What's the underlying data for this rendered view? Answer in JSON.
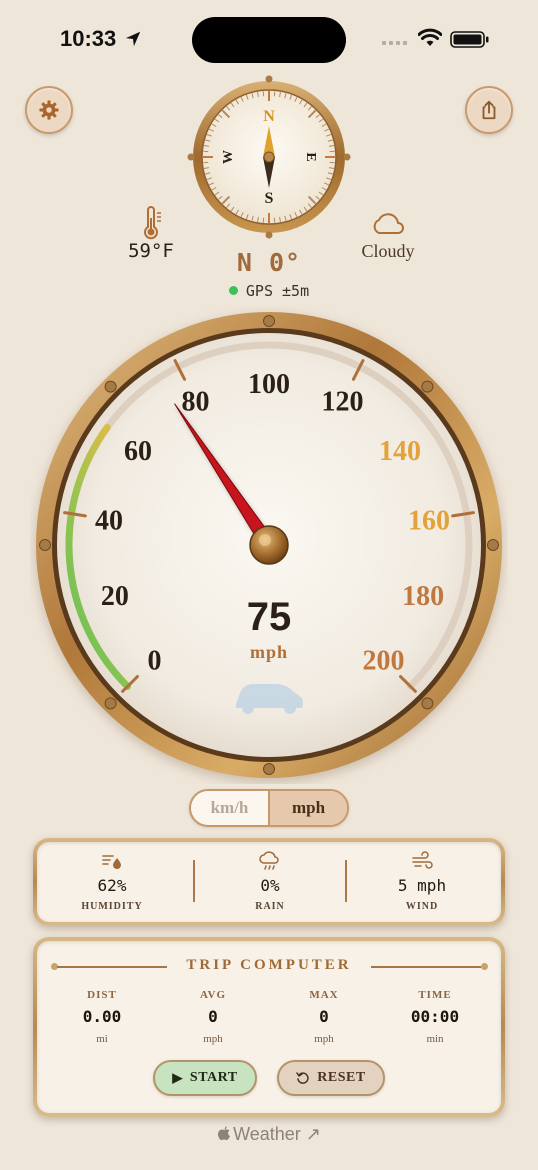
{
  "status": {
    "time": "10:33"
  },
  "header": {
    "temperature": "59°F",
    "condition": "Cloudy",
    "heading": "N 0°",
    "gps": "GPS ±5m"
  },
  "compass": {
    "n": "N",
    "e": "E",
    "s": "S",
    "w": "W"
  },
  "speedometer": {
    "speed": "75",
    "unit": "mph",
    "ticks": [
      {
        "label": "0",
        "warn": false
      },
      {
        "label": "20",
        "warn": false
      },
      {
        "label": "40",
        "warn": false
      },
      {
        "label": "60",
        "warn": false
      },
      {
        "label": "80",
        "warn": false
      },
      {
        "label": "100",
        "warn": false
      },
      {
        "label": "120",
        "warn": false
      },
      {
        "label": "140",
        "warn": true
      },
      {
        "label": "160",
        "warn": true
      },
      {
        "label": "180",
        "warn": true
      },
      {
        "label": "200",
        "warn": true
      }
    ],
    "max": 200,
    "needle_value": 75
  },
  "units": {
    "km": "km/h",
    "mph": "mph",
    "selected": "mph"
  },
  "weather": {
    "humidity": {
      "value": "62%",
      "label": "HUMIDITY"
    },
    "rain": {
      "value": "0%",
      "label": "RAIN"
    },
    "wind": {
      "value": "5 mph",
      "label": "WIND"
    }
  },
  "trip": {
    "title": "TRIP COMPUTER",
    "cols": [
      {
        "label": "DIST",
        "value": "0.00",
        "unit": "mi"
      },
      {
        "label": "AVG",
        "value": "0",
        "unit": "mph"
      },
      {
        "label": "MAX",
        "value": "0",
        "unit": "mph"
      },
      {
        "label": "TIME",
        "value": "00:00",
        "unit": "min"
      }
    ],
    "start": "START",
    "reset": "RESET"
  },
  "footer": {
    "text": "Weather ↗"
  },
  "colors": {
    "accent": "#a06a3a",
    "brass": "#b68a52",
    "needle": "#c8141c",
    "gauge_green": "#5cc25a",
    "gauge_warn": "#e6a23a"
  }
}
